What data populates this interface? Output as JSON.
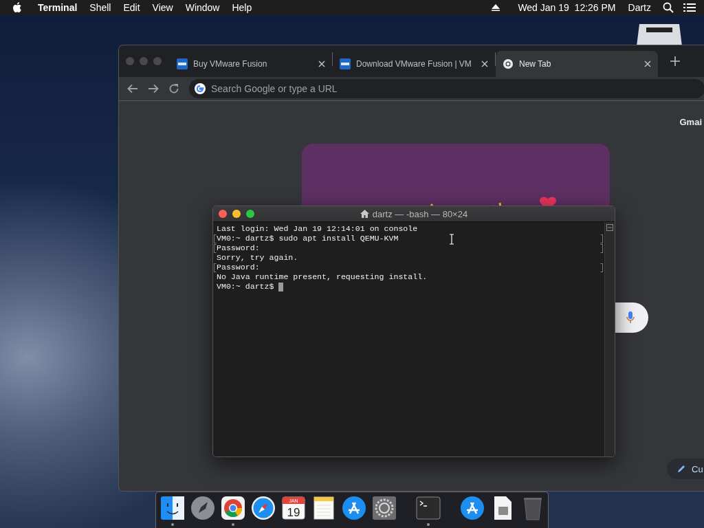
{
  "menubar": {
    "app": "Terminal",
    "menus": [
      "Shell",
      "Edit",
      "View",
      "Window",
      "Help"
    ],
    "clock": "Wed Jan 19  12:26 PM",
    "user": "Dartz"
  },
  "browser": {
    "tabs": [
      {
        "title": "Buy VMware Fusion",
        "kind": "vmware",
        "selected": false
      },
      {
        "title": "Download VMware Fusion | VM",
        "kind": "vmware",
        "selected": false
      },
      {
        "title": "New Tab",
        "kind": "chrome",
        "selected": true
      }
    ],
    "omnibox": {
      "placeholder": "Search Google or type a URL"
    },
    "gmail_link": "Gmai",
    "customize_button": "Cu"
  },
  "terminal": {
    "title": "dartz — -bash — 80×24",
    "lines": [
      {
        "text": "Last login: Wed Jan 19 12:14:01 on console",
        "marked": false,
        "cursor": false
      },
      {
        "text": "VM0:~ dartz$ sudo apt install QEMU-KVM",
        "marked": true,
        "cursor": false
      },
      {
        "text": "Password:",
        "marked": true,
        "cursor": false
      },
      {
        "text": "Sorry, try again.",
        "marked": false,
        "cursor": false
      },
      {
        "text": "Password:",
        "marked": true,
        "cursor": false
      },
      {
        "text": "No Java runtime present, requesting install.",
        "marked": false,
        "cursor": false
      },
      {
        "text": "VM0:~ dartz$ ",
        "marked": false,
        "cursor": true
      }
    ]
  },
  "dock": {
    "items": [
      {
        "kind": "finder",
        "running": true
      },
      {
        "kind": "launchpad",
        "running": false
      },
      {
        "kind": "chrome",
        "running": true
      },
      {
        "kind": "safari",
        "running": false
      },
      {
        "kind": "calendar",
        "month": "JAN",
        "day": "19",
        "running": false
      },
      {
        "kind": "notes",
        "running": false
      },
      {
        "kind": "appstore",
        "running": false
      },
      {
        "kind": "settings",
        "running": false
      },
      {
        "kind": "separator"
      },
      {
        "kind": "terminal",
        "running": true
      },
      {
        "kind": "separator"
      },
      {
        "kind": "appstore",
        "running": false
      },
      {
        "kind": "file",
        "running": false
      },
      {
        "kind": "trash",
        "running": false
      }
    ]
  }
}
